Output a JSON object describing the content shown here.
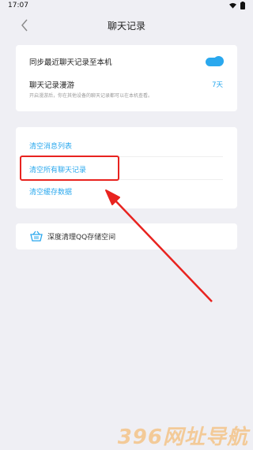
{
  "status": {
    "time": "17:07",
    "wifi_icon": "wifi-icon",
    "signal_icon": "signal-icon",
    "battery_icon": "battery-icon"
  },
  "header": {
    "title": "聊天记录",
    "back_icon": "chevron-left-icon"
  },
  "sync": {
    "label": "同步最近聊天记录至本机",
    "enabled": true
  },
  "roaming": {
    "label": "聊天记录漫游",
    "value": "7天",
    "description": "开启漫游后，你在其他设备的聊天记录都可以在本机查看。"
  },
  "clear_actions": [
    {
      "label": "清空消息列表"
    },
    {
      "label": "清空所有聊天记录"
    },
    {
      "label": "清空缓存数据"
    }
  ],
  "deep_clean": {
    "label": "深度清理QQ存储空间",
    "icon": "basket-icon"
  },
  "watermark": "396网址导航",
  "colors": {
    "accent": "#2aa8ee",
    "highlight": "#e8231f",
    "background": "#efeff4"
  }
}
